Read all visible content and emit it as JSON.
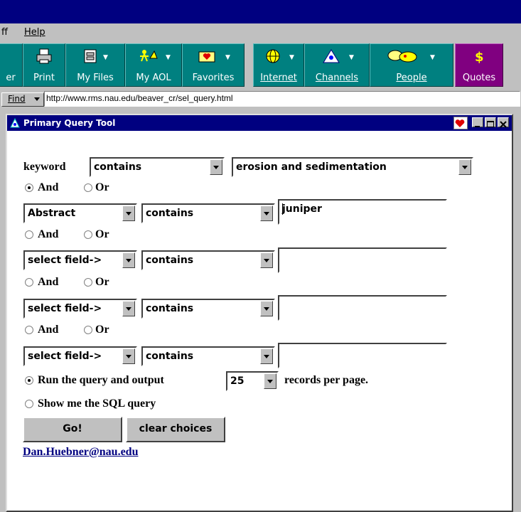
{
  "menu": {
    "partial_item": "ff",
    "help": "Help"
  },
  "toolbar": {
    "partial_label": "er",
    "print": "Print",
    "my_files": "My Files",
    "my_aol": "My AOL",
    "favorites": "Favorites",
    "internet": "Internet",
    "channels": "Channels",
    "people": "People",
    "quotes": "Quotes"
  },
  "address": {
    "find_label": "Find",
    "url": "http://www.rms.nau.edu/beaver_cr/sel_query.html"
  },
  "window": {
    "title": "Primary Query Tool"
  },
  "form": {
    "row0": {
      "label": "keyword",
      "operator": "contains",
      "value": "erosion and sedimentation"
    },
    "and_label": "And",
    "or_label": "Or",
    "row1": {
      "field": "Abstract",
      "operator": "contains",
      "value": "juniper"
    },
    "row2": {
      "field": "select field->",
      "operator": "contains",
      "value": ""
    },
    "row3": {
      "field": "select field->",
      "operator": "contains",
      "value": ""
    },
    "row4": {
      "field": "select field->",
      "operator": "contains",
      "value": ""
    },
    "run_label": "Run the query and output",
    "records_count": "25",
    "records_suffix": "records per page.",
    "show_sql_label": "Show me the SQL query",
    "go_button": "Go!",
    "clear_button": "clear choices",
    "email": "Dan.Huebner@nau.edu"
  },
  "colors": {
    "title_bar": "#000080",
    "toolbar_teal": "#008080",
    "toolbar_purple": "#800080",
    "face": "#c0c0c0"
  }
}
